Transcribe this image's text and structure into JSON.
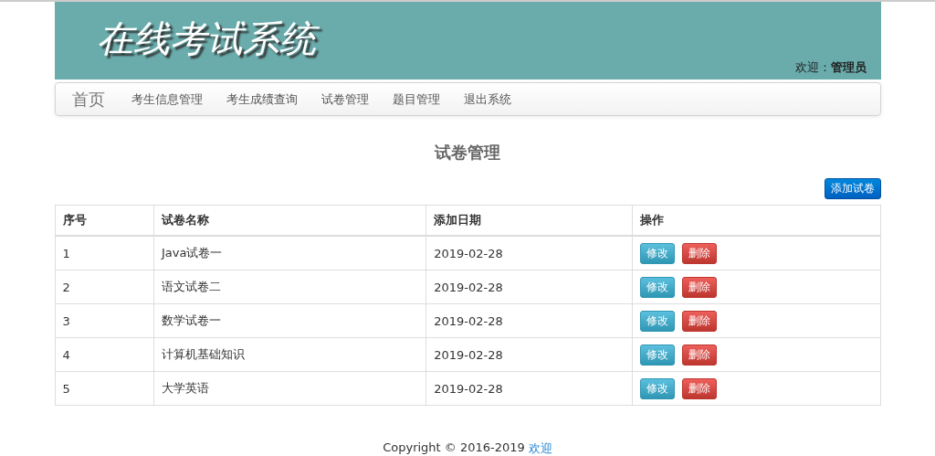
{
  "header": {
    "title": "在线考试系统",
    "welcome": "欢迎：**管理员**"
  },
  "nav": {
    "brand": "首页",
    "items": [
      {
        "label": "考生信息管理"
      },
      {
        "label": "考生成绩查询"
      },
      {
        "label": "试卷管理"
      },
      {
        "label": "题目管理"
      },
      {
        "label": "退出系统"
      }
    ]
  },
  "page_title": "试卷管理",
  "add_button": "添加试卷",
  "table": {
    "columns": [
      "序号",
      "试卷名称",
      "添加日期",
      "操作"
    ],
    "rows": [
      {
        "cells": [
          "1",
          "Java试卷一",
          "2019-02-28"
        ],
        "actions": [
          "修改",
          "删除"
        ]
      },
      {
        "cells": [
          "2",
          "语文试卷二",
          "2019-02-28"
        ],
        "actions": [
          "修改",
          "删除"
        ]
      },
      {
        "cells": [
          "3",
          "数学试卷一",
          "2019-02-28"
        ],
        "actions": [
          "修改",
          "删除"
        ]
      },
      {
        "cells": [
          "4",
          "计算机基础知识",
          "2019-02-28"
        ],
        "actions": [
          "修改",
          "删除"
        ]
      },
      {
        "cells": [
          "5",
          "大学英语",
          "2019-02-28"
        ],
        "actions": [
          "修改",
          "删除"
        ]
      }
    ]
  },
  "footer": {
    "copyright": "Copyright © 2016-2019",
    "link": "欢迎"
  }
}
